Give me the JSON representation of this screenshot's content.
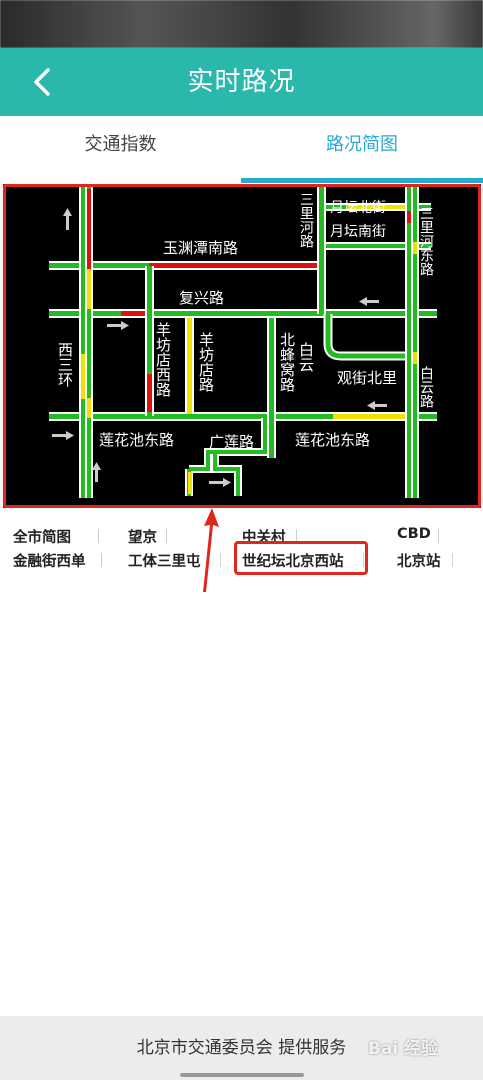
{
  "header": {
    "title": "实时路况",
    "back_icon": "back-arrow-icon"
  },
  "tabs": [
    {
      "label": "交通指数",
      "active": false
    },
    {
      "label": "路况简图",
      "active": true
    }
  ],
  "map": {
    "labels": {
      "yuanshan": "玉渊潭南路",
      "fuxing": "复兴路",
      "xisanhuan": "西三环",
      "yangfangdianxilu": "羊坊店西路",
      "yangfangdianlu": "羊坊店路",
      "beifengwolu": "北蜂窝路",
      "baiyun": "白云",
      "guanjiebeili": "观街北里",
      "lianhuachidonglu_w": "莲花池东路",
      "guanglianlu": "广莲路",
      "lianhuachidonglu_e": "莲花池东路",
      "sanlihelu": "三里河路",
      "yuetanbeijie": "月坛北街",
      "yuetannanjie": "月坛南街",
      "sanlihedonglu": "三里河东路",
      "baiyunlu": "白云路"
    },
    "colors": {
      "free": "#22bb22",
      "slow": "#f2e000",
      "jam": "#dd1111",
      "background": "#000000",
      "road_edge": "#ffffff"
    }
  },
  "shortcuts": [
    {
      "label": "全市简图"
    },
    {
      "label": "望京"
    },
    {
      "label": "中关村"
    },
    {
      "label": "CBD"
    },
    {
      "label": "金融街西单"
    },
    {
      "label": "工体三里屯"
    },
    {
      "label": "世纪坛北京西站"
    },
    {
      "label": "北京站"
    }
  ],
  "footer": {
    "text": "北京市交通委员会 提供服务",
    "watermark": "Bai 经验"
  }
}
